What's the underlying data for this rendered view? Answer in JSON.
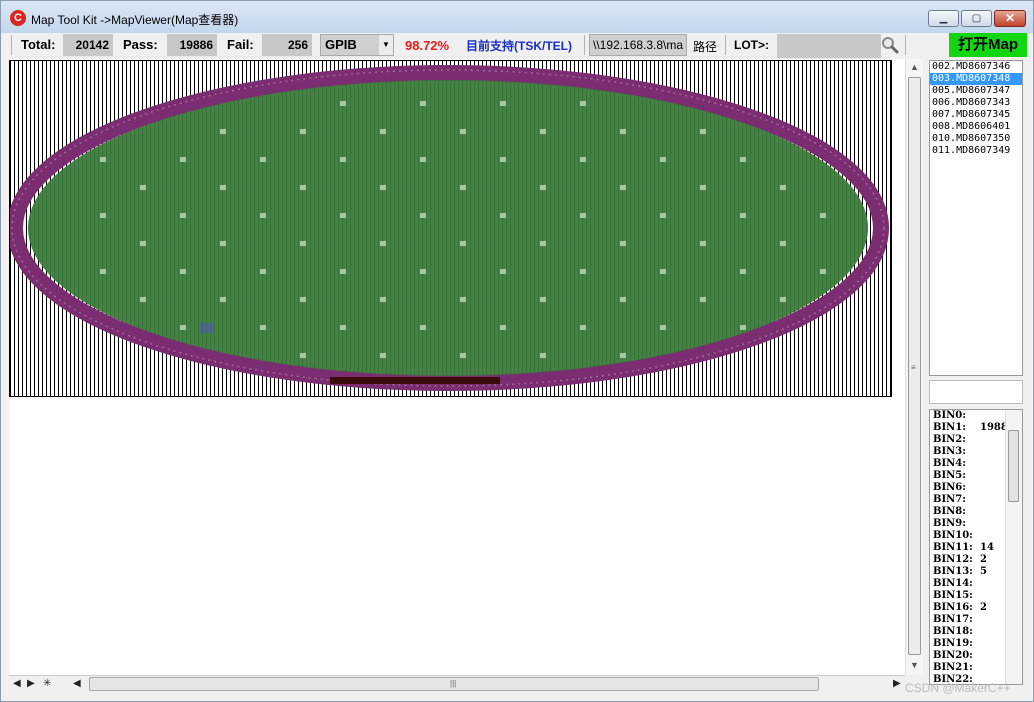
{
  "window": {
    "title": "Map Tool Kit ->MapViewer(Map查看器)",
    "minimize_glyph": "▁",
    "maximize_glyph": "▢",
    "close_glyph": "✕"
  },
  "toolbar": {
    "total_label": "Total:",
    "total_value": "20142",
    "pass_label": "Pass:",
    "pass_value": "19886",
    "fail_label": "Fail:",
    "fail_value": "256",
    "mode_value": "GPIB",
    "yield": "98.72%",
    "support_text": "目前支持(TSK/TEL)",
    "path_value": "\\\\192.168.3.8\\ma",
    "path_button": "路径",
    "lot_label": "LOT>:",
    "open_map_label": "打开Map"
  },
  "wafer_list": {
    "items": [
      {
        "label": "002.MD8607346",
        "selected": false
      },
      {
        "label": "003.MD8607348",
        "selected": true
      },
      {
        "label": "005.MD8607347",
        "selected": false
      },
      {
        "label": "006.MD8607343",
        "selected": false
      },
      {
        "label": "007.MD8607345",
        "selected": false
      },
      {
        "label": "008.MD8606401",
        "selected": false
      },
      {
        "label": "010.MD8607350",
        "selected": false
      },
      {
        "label": "011.MD8607349",
        "selected": false
      }
    ]
  },
  "bins": [
    {
      "label": "BIN0:",
      "value": ""
    },
    {
      "label": "BIN1:",
      "value": "1988"
    },
    {
      "label": "BIN2:",
      "value": ""
    },
    {
      "label": "BIN3:",
      "value": ""
    },
    {
      "label": "BIN4:",
      "value": ""
    },
    {
      "label": "BIN5:",
      "value": ""
    },
    {
      "label": "BIN6:",
      "value": ""
    },
    {
      "label": "BIN7:",
      "value": ""
    },
    {
      "label": "BIN8:",
      "value": ""
    },
    {
      "label": "BIN9:",
      "value": ""
    },
    {
      "label": "BIN10:",
      "value": ""
    },
    {
      "label": "BIN11:",
      "value": "14"
    },
    {
      "label": "BIN12:",
      "value": "2"
    },
    {
      "label": "BIN13:",
      "value": "5"
    },
    {
      "label": "BIN14:",
      "value": ""
    },
    {
      "label": "BIN15:",
      "value": ""
    },
    {
      "label": "BIN16:",
      "value": "2"
    },
    {
      "label": "BIN17:",
      "value": ""
    },
    {
      "label": "BIN18:",
      "value": ""
    },
    {
      "label": "BIN19:",
      "value": ""
    },
    {
      "label": "BIN20:",
      "value": ""
    },
    {
      "label": "BIN21:",
      "value": ""
    },
    {
      "label": "BIN22:",
      "value": ""
    }
  ],
  "hscroll": {
    "prev_glyph": "◀",
    "next_glyph": "▶",
    "star_glyph": "✳",
    "grip": "|||",
    "left_glyph": "◀",
    "right_glyph": "▶"
  },
  "vscroll": {
    "up": "▲",
    "down": "▼",
    "grip": "≡"
  },
  "colors": {
    "pass_die": "#3a7a3a",
    "edge_die": "#7b2d72",
    "fail_die": "#3b0c0c",
    "open_map_bg": "#11d611",
    "yield_text": "#e02020"
  },
  "watermark": "CSDN @MakerC++"
}
